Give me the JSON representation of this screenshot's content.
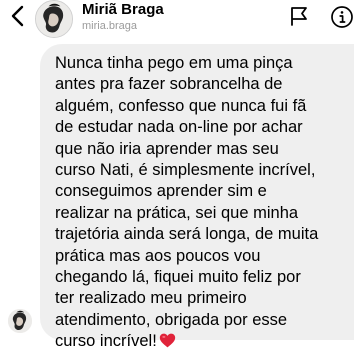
{
  "header": {
    "back_icon": "chevron-left-icon",
    "contact_name": "Miriã Braga",
    "contact_username": "miria.braga",
    "flag_icon": "flag-icon",
    "info_icon": "info-icon"
  },
  "message": {
    "text": "Nunca tinha pego em uma pinça\nantes pra fazer sobrancelha de\nalguém, confesso que nunca fui fã\nde estudar nada on-line por achar\nque não iria aprender mas seu\ncurso Nati, é simplesmente incrível,\nconseguimos aprender sim e\nrealizar na prática, sei que minha\ntrajetória ainda será longa, de muita\nprática mas aos poucos vou\nchegando lá, fiquei muito feliz por\nter realizado meu primeiro\natendimento, obrigada por esse\ncurso incrível!",
    "emoji": "❤️",
    "bubble_color": "#efefef",
    "heart_color": "#e0233a"
  },
  "colors": {
    "username": "#9b9b9b",
    "text": "#000000"
  }
}
